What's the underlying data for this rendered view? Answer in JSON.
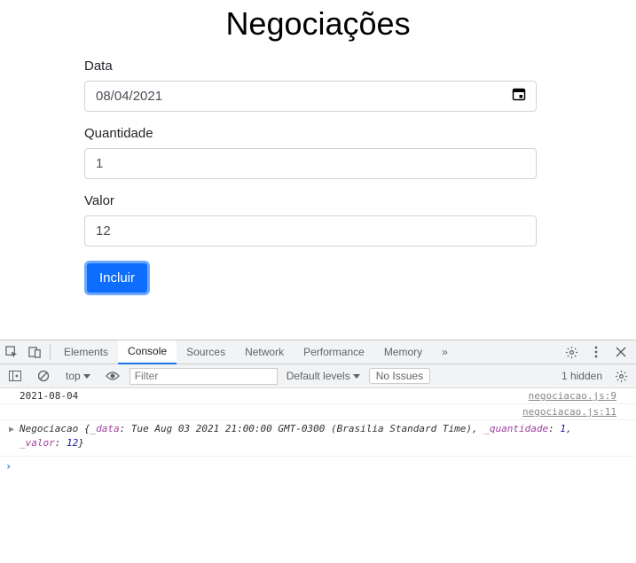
{
  "page": {
    "title": "Negociações",
    "labels": {
      "data": "Data",
      "quantidade": "Quantidade",
      "valor": "Valor"
    },
    "values": {
      "data": "08/04/2021",
      "quantidade": "1",
      "valor": "12"
    },
    "submit": "Incluir"
  },
  "devtools": {
    "tabs": {
      "elements": "Elements",
      "console": "Console",
      "sources": "Sources",
      "network": "Network",
      "performance": "Performance",
      "memory": "Memory"
    },
    "toolbar": {
      "context": "top",
      "filter_placeholder": "Filter",
      "levels": "Default levels",
      "issues": "No Issues",
      "hidden": "1 hidden"
    },
    "log": {
      "line1_msg": "2021-08-04",
      "line1_src": "negociacao.js:9",
      "line2_src": "negociacao.js:11",
      "obj_class": "Negociacao",
      "obj_key_data": "_data",
      "obj_val_data": "Tue Aug 03 2021 21:00:00 GMT-0300 (Brasilia Standard Time)",
      "obj_key_quant": "_quantidade",
      "obj_val_quant": "1",
      "obj_key_valor": "_valor",
      "obj_val_valor": "12"
    }
  }
}
